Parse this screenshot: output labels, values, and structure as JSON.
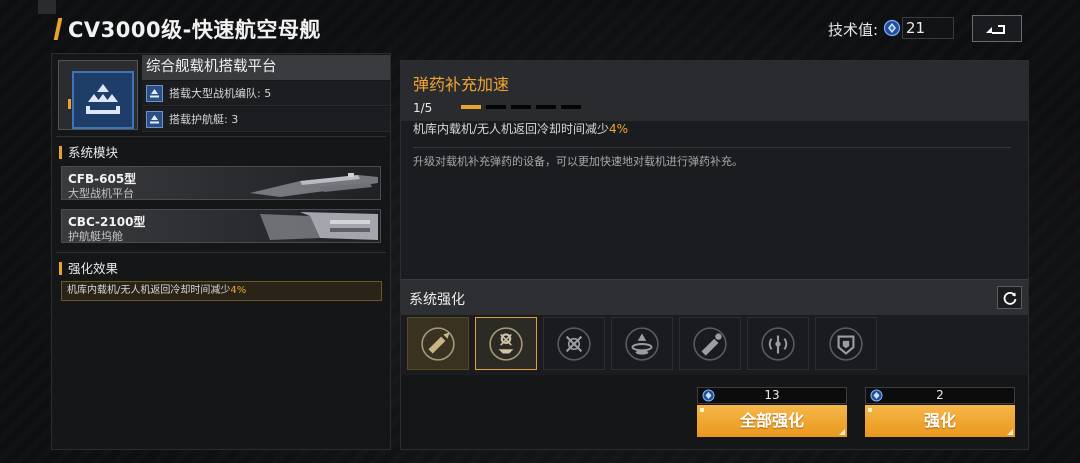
{
  "header": {
    "title": "CV3000级-快速航空母舰",
    "tech_label": "技术值:",
    "tech_value": "21",
    "tech_icon": "tech-crystal-icon",
    "back_icon": "back-return-icon"
  },
  "colors": {
    "accent": "#e8a32c",
    "highlight_text": "#f0a52e",
    "icon_blue": "#3f74b9"
  },
  "platform": {
    "title": "综合舰载机搭载平台",
    "icon": "carrier-platform-icon",
    "rows": [
      {
        "label": "搭载大型战机编队: 5",
        "icon": "aircraft-squadron-icon"
      },
      {
        "label": "搭载护航艇: 3",
        "icon": "escort-boat-icon"
      }
    ]
  },
  "modules": {
    "heading": "系统模块",
    "items": [
      {
        "title": "CFB-605型",
        "subtitle": "大型战机平台"
      },
      {
        "title": "CBC-2100型",
        "subtitle": "护航艇坞舱"
      }
    ]
  },
  "effect": {
    "heading": "强化效果",
    "text": "机库内载机/无人机返回冷却时间减少",
    "value": "4%"
  },
  "detail": {
    "title": "弹药补充加速",
    "level": "1/5",
    "level_current": 1,
    "level_max": 5,
    "desc_text": "机库内载机/无人机返回冷却时间减少",
    "desc_value": "4%",
    "body": "升级对载机补充弹药的设备，可以更加快速地对载机进行弹药补充。"
  },
  "enhance": {
    "title": "系统强化",
    "refresh_icon": "refresh-icon",
    "slots": [
      {
        "icon": "missile-pod-icon",
        "state": "filled"
      },
      {
        "icon": "ammo-reload-icon",
        "state": "selected"
      },
      {
        "icon": "hangar-cooldown-icon",
        "state": "empty"
      },
      {
        "icon": "landing-beacon-icon",
        "state": "empty"
      },
      {
        "icon": "torpedo-icon",
        "state": "empty"
      },
      {
        "icon": "signal-tower-icon",
        "state": "empty"
      },
      {
        "icon": "armor-plate-icon",
        "state": "empty"
      }
    ]
  },
  "actions": {
    "enhance_all": {
      "cost": "13",
      "label": "全部强化"
    },
    "enhance": {
      "cost": "2",
      "label": "强化"
    }
  }
}
